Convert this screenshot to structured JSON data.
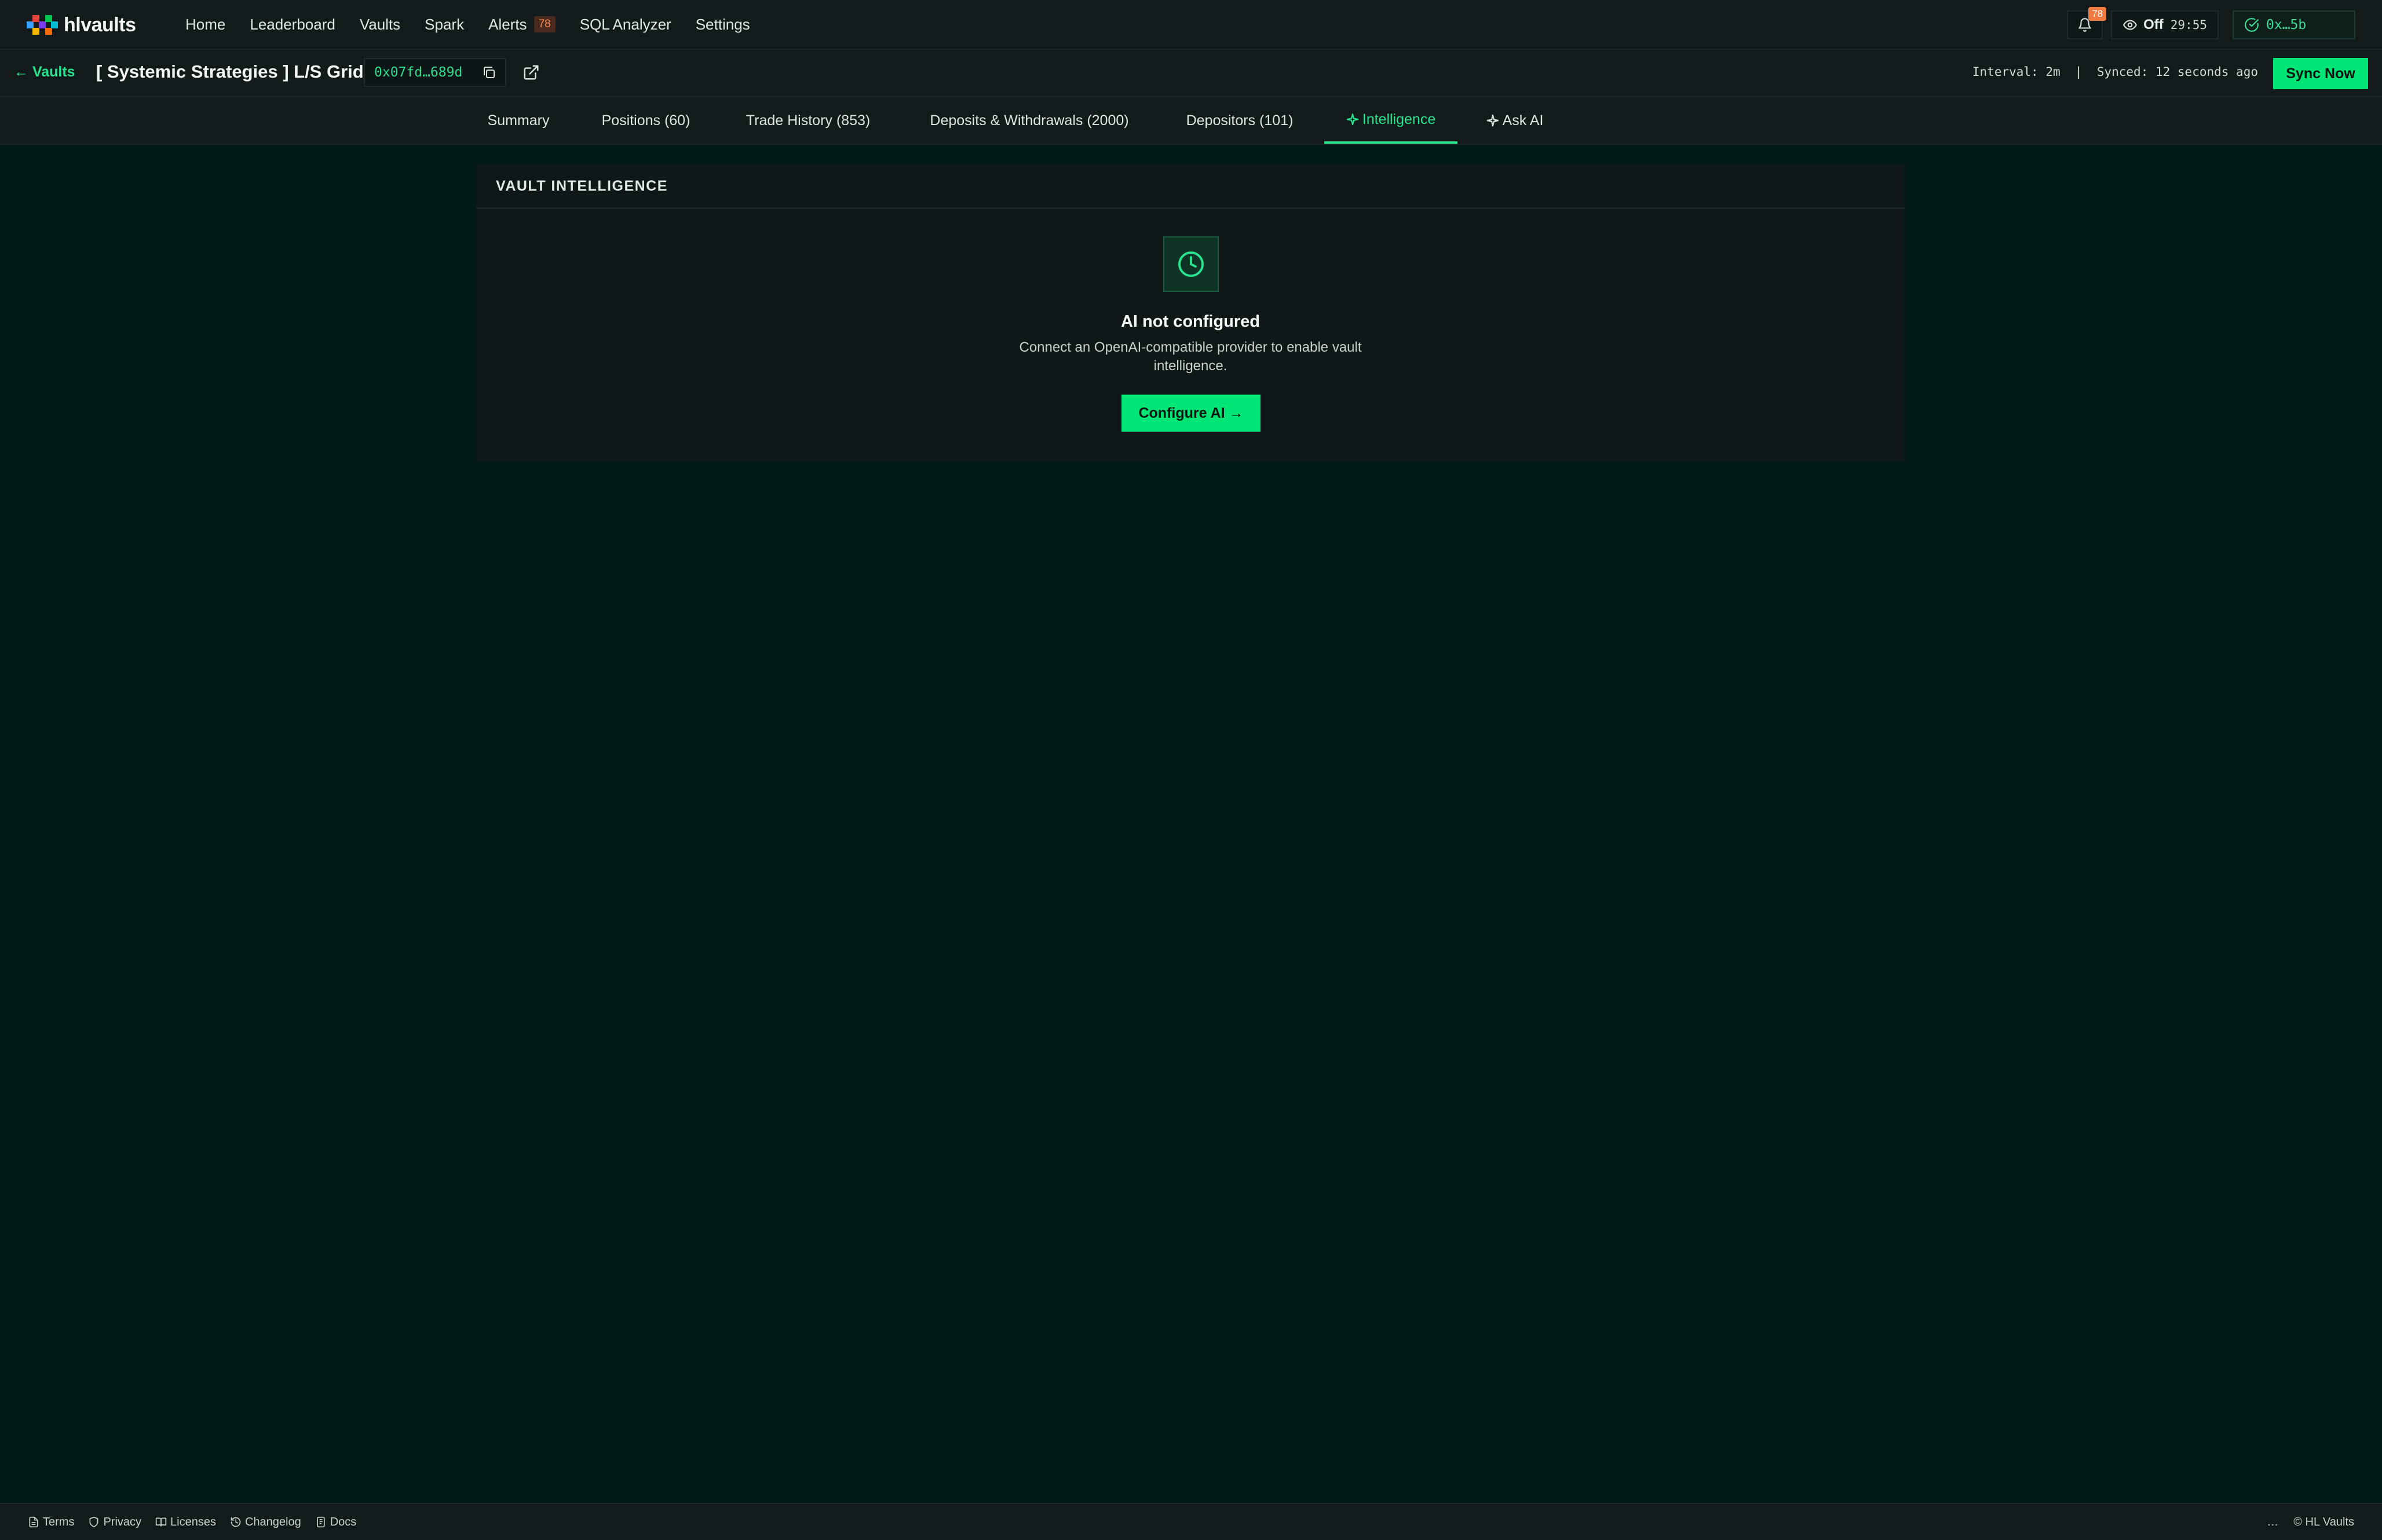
{
  "brand": {
    "name": "hlvaults"
  },
  "nav": {
    "items": [
      {
        "label": "Home"
      },
      {
        "label": "Leaderboard"
      },
      {
        "label": "Vaults"
      },
      {
        "label": "Spark"
      },
      {
        "label": "Alerts",
        "badge": "78"
      },
      {
        "label": "SQL Analyzer"
      },
      {
        "label": "Settings"
      }
    ]
  },
  "topright": {
    "notifications_count": "78",
    "watch_label": "Off",
    "watch_timer": "29:55",
    "wallet": "0x…5b"
  },
  "subheader": {
    "back_label": "← Vaults",
    "vault_name": "[ Systemic Strategies ] L/S Grids",
    "address": "0x07fd…689d",
    "sync_info": "Interval: 2m  |  Synced: 12 seconds ago",
    "sync_button": "Sync Now"
  },
  "tabs": [
    {
      "label": "Summary"
    },
    {
      "label": "Positions (60)"
    },
    {
      "label": "Trade History (853)"
    },
    {
      "label": "Deposits & Withdrawals (2000)"
    },
    {
      "label": "Depositors (101)"
    },
    {
      "label": "Intelligence",
      "active": true
    },
    {
      "label": "Ask AI"
    }
  ],
  "panel": {
    "title": "VAULT INTELLIGENCE",
    "icon": "clock-icon",
    "empty_title": "AI not configured",
    "empty_desc": "Connect an OpenAI-compatible provider to enable vault intelligence.",
    "button": "Configure AI →"
  },
  "footer": {
    "links": [
      {
        "label": "Terms",
        "icon": "document-icon"
      },
      {
        "label": "Privacy",
        "icon": "shield-icon"
      },
      {
        "label": "Licenses",
        "icon": "book-icon"
      },
      {
        "label": "Changelog",
        "icon": "history-icon"
      },
      {
        "label": "Docs",
        "icon": "docs-icon"
      }
    ],
    "ellipsis": "…",
    "copyright": "© HL Vaults"
  },
  "colors": {
    "accent": "#00e676",
    "background": "#021a15",
    "surface": "#121a1b",
    "alert_badge": "#f07a3f"
  }
}
